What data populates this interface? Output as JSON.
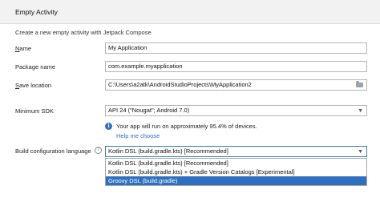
{
  "header": {
    "title": "Empty Activity"
  },
  "subtitle": "Create a new empty activity with Jetpack Compose",
  "form": {
    "name": {
      "label_ul": "N",
      "label_rest": "ame",
      "value": "My Application"
    },
    "package": {
      "label": "Package name",
      "value": "com.example.myapplication"
    },
    "save": {
      "label_ul": "S",
      "label_rest": "ave location",
      "value": "C:\\Users\\a2atk\\AndroidStudioProjects\\MyApplication2"
    },
    "min_sdk": {
      "label": "Minimum SDK",
      "value": "API 24 (\"Nougat\"; Android 7.0)"
    },
    "info": {
      "text": "Your app will run on approximately 95.4% of devices.",
      "link": "Help me choose"
    },
    "build": {
      "label": "Build configuration language",
      "value": "Kotlin DSL (build.gradle.kts) [Recommended]",
      "options": [
        "Kotlin DSL (build.gradle.kts) [Recommended]",
        "Kotlin DSL (build.gradle.kts) + Gradle Version Catalogs [Experimental]",
        "Groovy DSL (build.gradle)"
      ],
      "highlighted_option": "Groovy DSL (build.gradle)"
    }
  }
}
